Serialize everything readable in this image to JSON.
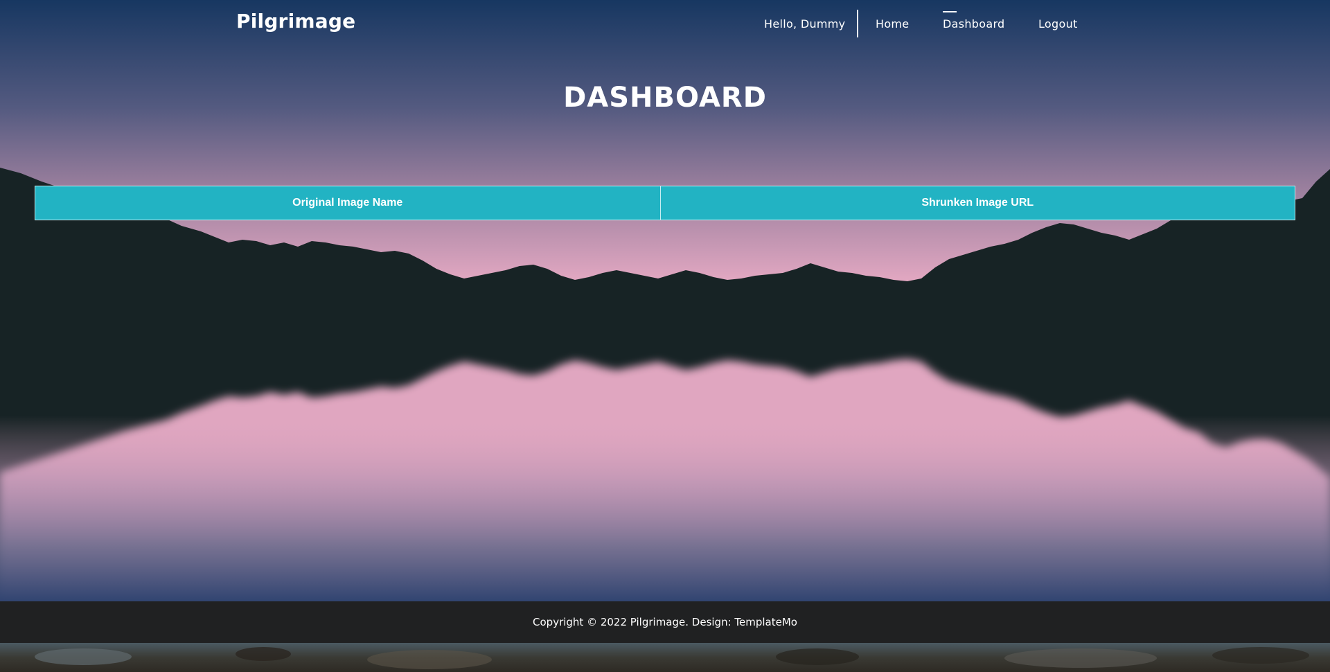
{
  "header": {
    "logo": "Pilgrimage",
    "greeting": "Hello, Dummy",
    "nav": {
      "home": "Home",
      "dashboard": "Dashboard",
      "logout": "Logout"
    },
    "active_nav": "Dashboard"
  },
  "main": {
    "title": "DASHBOARD",
    "table": {
      "columns": [
        "Original Image Name",
        "Shrunken Image URL"
      ],
      "rows": []
    }
  },
  "footer": {
    "text": "Copyright © 2022 Pilgrimage. Design: ",
    "link": "TemplateMo"
  },
  "colors": {
    "accent": "#22b3c3",
    "footer_bg": "#202122",
    "sky_top": "#1a3a62",
    "sky_pink": "#e3a8c2",
    "mountain": "#172325"
  }
}
